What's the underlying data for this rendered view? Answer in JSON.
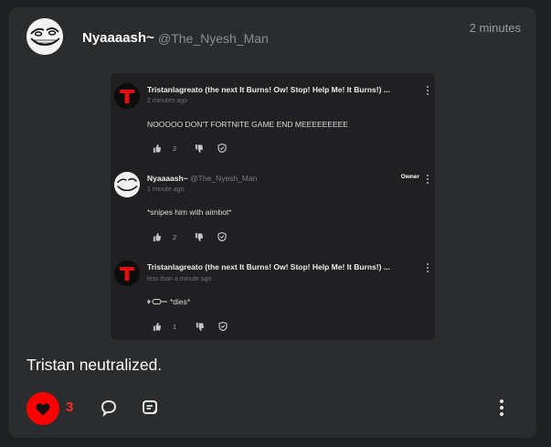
{
  "post": {
    "author": "Nyaaaash~",
    "handle": "@The_Nyesh_Man",
    "time": "2 minutes",
    "text": "Tristan neutralized.",
    "like_count": "3",
    "avatar_icon": "troll-face-avatar"
  },
  "embed": {
    "comments": [
      {
        "author": "Tristanlagreato (the next It Burns! Ow! Stop! Help Me! It Burns!) ...",
        "time": "2 minutes ago",
        "body": "NOOOOO DON'T FORTNITE GAME END MEEEEEEEEE",
        "likes": "2",
        "avatar_icon": "red-t-logo-avatar"
      },
      {
        "author": "Nyaaaash~",
        "handle": "@The_Nyesh_Man",
        "badge": "Owner",
        "time": "1 minute ago",
        "body": "*snipes him with aimbot*",
        "likes": "2",
        "avatar_icon": "troll-face-avatar"
      },
      {
        "author": "Tristanlagreato (the next It Burns! Ow! Stop! Help Me! It Burns!) ...",
        "time": "less than a minute ago",
        "body": "*dies*",
        "likes": "1",
        "avatar_icon": "red-t-logo-avatar"
      }
    ]
  },
  "colors": {
    "background": "#1f2021",
    "card": "#2a2c2d",
    "embed": "#202023",
    "like_accent": "#ff0000"
  }
}
